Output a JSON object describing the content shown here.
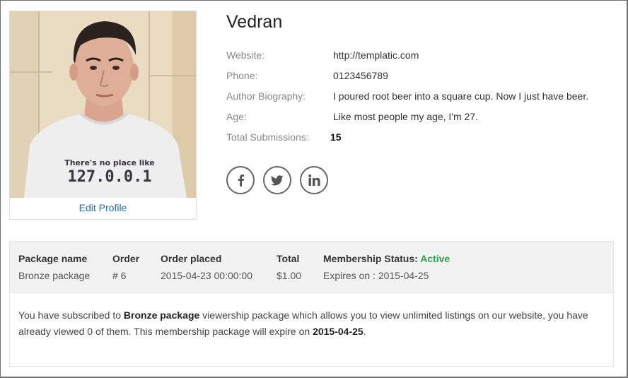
{
  "profile": {
    "name": "Vedran",
    "edit_label": "Edit Profile",
    "photo_shirt_line1": "There's no place like",
    "photo_shirt_line2": "127.0.0.1"
  },
  "details": [
    {
      "label": "Website:",
      "value": "http://templatic.com"
    },
    {
      "label": "Phone:",
      "value": "0123456789"
    },
    {
      "label": "Author Biography:",
      "value": "I poured root beer into a square cup. Now I just have beer."
    },
    {
      "label": "Age:",
      "value": "Like most people my age, I'm 27."
    },
    {
      "label": "Total Submissions:",
      "value": "15"
    }
  ],
  "socials": [
    {
      "icon": "facebook-icon",
      "glyph": "f"
    },
    {
      "icon": "twitter-icon",
      "glyph": "t"
    },
    {
      "icon": "linkedin-icon",
      "glyph": "in"
    }
  ],
  "membership": {
    "headers": {
      "package_name": "Package name",
      "order": "Order",
      "order_placed": "Order placed",
      "total": "Total",
      "status": "Membership Status:",
      "status_value": "Active"
    },
    "row": {
      "package_name": "Bronze package",
      "order": "# 6",
      "order_placed": "2015-04-23 00:00:00",
      "total": "$1.00",
      "expires": "Expires on : 2015-04-25"
    },
    "message": {
      "part1": "You have subscribed to ",
      "package": "Bronze package",
      "part2": " viewership package which allows you to view unlimited listings on our website, you have already viewed 0 of them. This membership package will expire on ",
      "expiry": "2015-04-25",
      "part3": "."
    },
    "colors": {
      "active": "#2aa34a",
      "link": "#1a73b8"
    }
  }
}
